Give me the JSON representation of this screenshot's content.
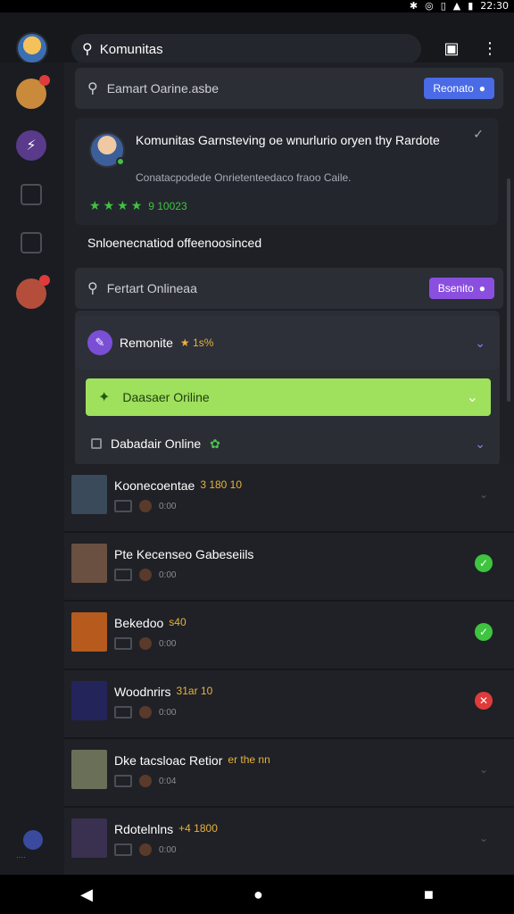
{
  "status_bar": {
    "icons": [
      "bluetooth-icon",
      "alarm-icon",
      "vibrate-icon",
      "signal-icon",
      "wifi-icon",
      "battery-icon"
    ],
    "time": "22:30"
  },
  "topbar": {
    "search_query": "Komunitas"
  },
  "filter1": {
    "label": "Eamart Oarine.asbe",
    "button": "Reonato"
  },
  "card": {
    "title": "Komunitas Garnsteving oe wnurlurio oryen thy Rardote",
    "subtitle": "Conatacpodede Onrietenteedaco fraoo Caile.",
    "rating": "9 10023"
  },
  "section_label": "Snloenecnatiod offeenoosinced",
  "filter2": {
    "label": "Fertart Onlineaa",
    "button": "Bsenito"
  },
  "panel": {
    "row1_title": "Remonite",
    "row1_score": "★ 1s%",
    "green_label": "Daasaer Oriline",
    "check_label": "Dabadair Online"
  },
  "users": [
    {
      "name": "Koonecoentae",
      "score": "3 180 10",
      "meta": "0:00",
      "status": "none",
      "avatar_color": "#3a4a5a"
    },
    {
      "name": "Pte Kecenseo Gabeseiils",
      "score": "",
      "meta": "0:00",
      "status": "ok",
      "avatar_color": "#6a5040"
    },
    {
      "name": "Bekedoo",
      "score": "s40",
      "meta": "0:00",
      "status": "ok",
      "avatar_color": "#b65a1e"
    },
    {
      "name": "Woodnrirs",
      "score": "31ar 10",
      "meta": "0:00",
      "status": "fail",
      "avatar_color": "#23245a"
    },
    {
      "name": "Dke tacsloac Retior",
      "score": "er the nn",
      "meta": "0:04",
      "status": "none",
      "avatar_color": "#6a7058"
    },
    {
      "name": "Rdotelnlns",
      "score": "+4 1800",
      "meta": "0:00",
      "status": "none",
      "avatar_color": "#3a3050"
    }
  ],
  "colors": {
    "accent_blue": "#4a6ae6",
    "accent_purple": "#8b4fe0",
    "online_green": "#3ec43e",
    "highlight_green": "#9fe05c",
    "alert_red": "#e03b3b"
  },
  "navbar": {
    "back": "◀",
    "home": "●",
    "recent": "■"
  }
}
